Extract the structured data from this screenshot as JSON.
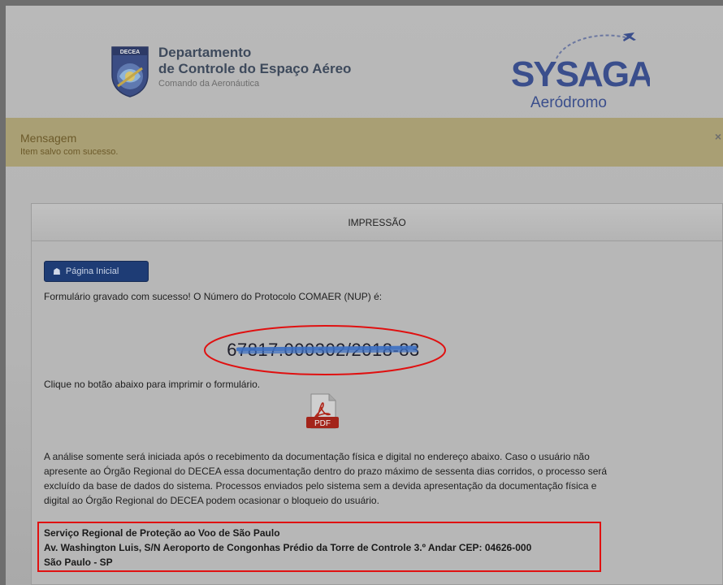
{
  "header": {
    "logo_badge": "DECEA",
    "org_line1": "Departamento",
    "org_line2": "de Controle do Espaço Aéreo",
    "org_sub": "Comando da Aeronáutica",
    "app_logo_main": "SYSAGA",
    "app_logo_sub": "Aeródromo"
  },
  "message": {
    "title": "Mensagem",
    "text": "Item salvo com sucesso.",
    "close": "×"
  },
  "panel": {
    "title": "IMPRESSÃO",
    "home_button": "Página Inicial",
    "home_icon": "home-icon",
    "success_text": "Formulário gravado com sucesso! O Número do Protocolo COMAER (NUP) é:",
    "nup_number": "67817.000302/2018-83",
    "print_instruction": "Clique no botão abaixo para imprimir o formulário.",
    "pdf_label": "PDF",
    "notice_text": "A análise somente será iniciada após o recebimento da documentação física e digital no endereço abaixo. Caso o usuário não apresente ao Órgão Regional do DECEA essa documentação dentro do prazo máximo de sessenta dias corridos, o processo será excluído da base de dados do sistema. Processos enviados pelo sistema sem a devida apresentação da documentação física e digital ao Órgão Regional do DECEA podem ocasionar o bloqueio do usuário.",
    "address": {
      "line1": "Serviço Regional de Proteção ao Voo de São Paulo",
      "line2": "Av. Washington Luis, S/N Aeroporto de Congonhas Prédio da Torre de Controle 3.º Andar CEP: 04626-000",
      "line3": "São Paulo - SP"
    }
  },
  "colors": {
    "message_bg": "#a99f74",
    "button_bg": "#1e3c75",
    "highlight_red": "#e01010",
    "logo_blue": "#3a4e8c"
  }
}
